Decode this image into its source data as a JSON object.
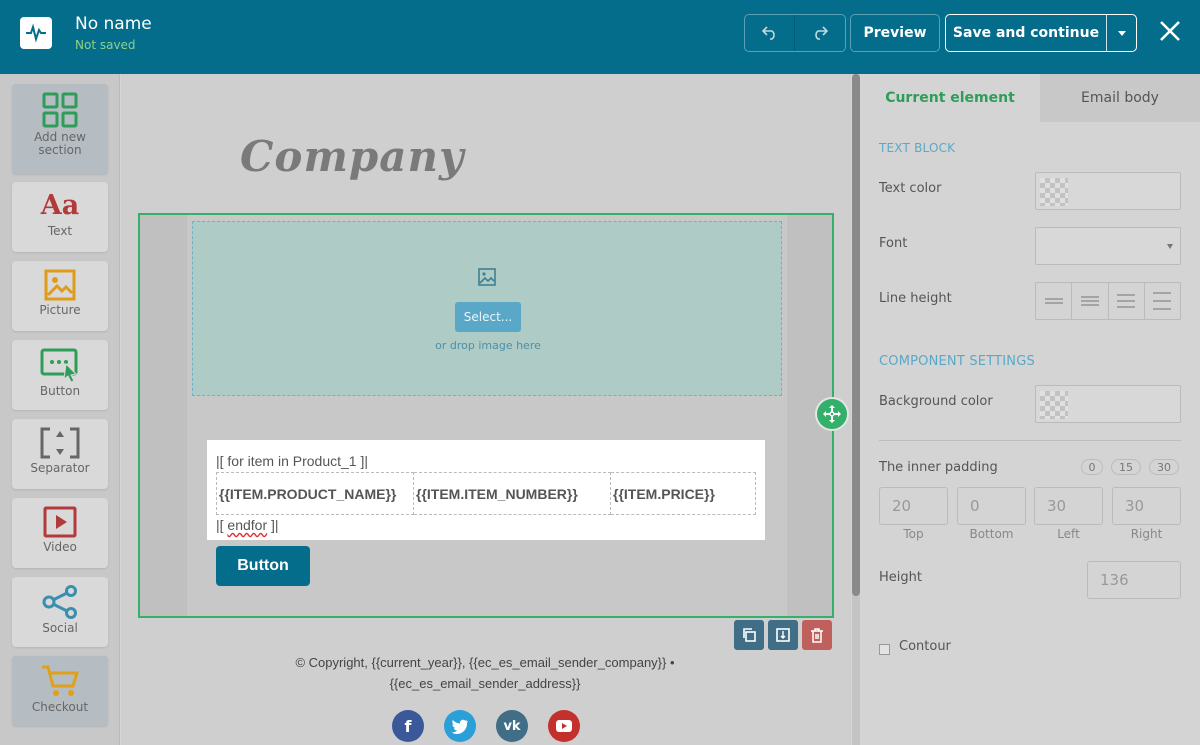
{
  "header": {
    "title": "No name",
    "status": "Not saved",
    "preview_label": "Preview",
    "save_label": "Save and continue"
  },
  "sidebar": {
    "items": [
      {
        "label": "Add new section",
        "icon": "grid-icon"
      },
      {
        "label": "Text",
        "icon": "text-aa-icon"
      },
      {
        "label": "Picture",
        "icon": "picture-icon"
      },
      {
        "label": "Button",
        "icon": "button-cursor-icon"
      },
      {
        "label": "Separator",
        "icon": "separator-icon"
      },
      {
        "label": "Video",
        "icon": "video-icon"
      },
      {
        "label": "Social",
        "icon": "share-icon"
      },
      {
        "label": "Checkout",
        "icon": "cart-icon"
      }
    ]
  },
  "canvas": {
    "company_logo": "Company",
    "image_select_label": "Select...",
    "image_drop_text": "or drop image here",
    "loop_start": "|[ for item in Product_1 ]|",
    "columns": [
      "{{ITEM.PRODUCT_NAME}}",
      "{{ITEM.ITEM_NUMBER}}",
      "{{ITEM.PRICE}}"
    ],
    "loop_end_prefix": "|[ ",
    "loop_end_word": "endfor",
    "loop_end_suffix": " ]|",
    "button_label": "Button",
    "footer_line1": "© Copyright, {{current_year}}, {{ec_es_email_sender_company}} •",
    "footer_line2": "{{ec_es_email_sender_address}}",
    "social_networks": [
      "facebook",
      "twitter",
      "vk",
      "youtube"
    ]
  },
  "panel": {
    "tabs": [
      "Current element",
      "Email body"
    ],
    "text_block_heading": "TEXT BLOCK",
    "text_color_label": "Text color",
    "font_label": "Font",
    "line_height_label": "Line height",
    "component_heading": "COMPONENT SETTINGS",
    "bg_color_label": "Background color",
    "inner_padding_label": "The inner padding",
    "padding_presets": [
      "0",
      "15",
      "30"
    ],
    "padding": {
      "top": {
        "value": "20",
        "label": "Top"
      },
      "bottom": {
        "value": "0",
        "label": "Bottom"
      },
      "left": {
        "value": "30",
        "label": "Left"
      },
      "right": {
        "value": "30",
        "label": "Right"
      }
    },
    "height_label": "Height",
    "height_value": "136",
    "contour_label": "Contour"
  },
  "colors": {
    "header_bg": "#046d8b",
    "accent_green": "#33b069",
    "button_blue": "#046d8b",
    "delete_red": "#d9534f"
  }
}
